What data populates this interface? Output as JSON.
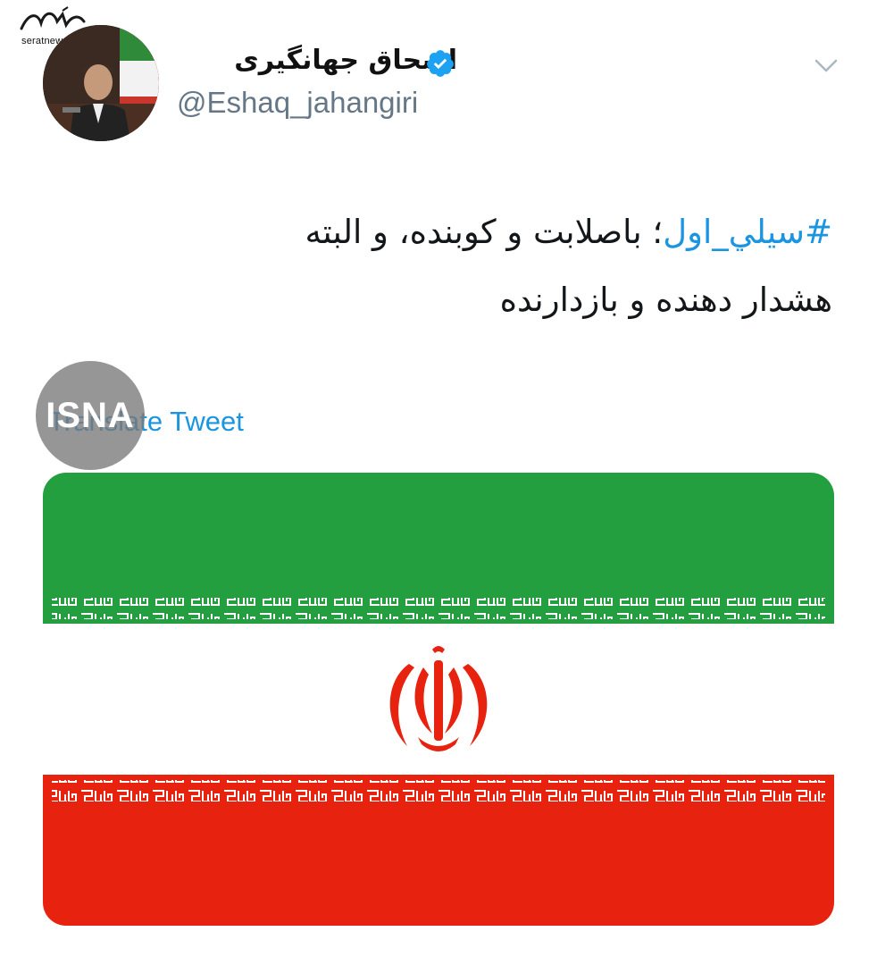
{
  "watermark": {
    "text": "seratnews.ir"
  },
  "tweet": {
    "author_name": "اسحاق جهانگیری",
    "handle": "@Eshaq_jahangiri",
    "hashtag": "#سیلي_اول",
    "text_line1_rest": "؛ باصلابت و کوبنده، و البته",
    "text_line2": "هشدار دهنده و بازدارنده",
    "translate_label": "Translate Tweet"
  },
  "overlay": {
    "isna_label": "ISNA"
  },
  "icons": {
    "verified": "verified-badge-icon",
    "chevron": "chevron-down-icon"
  },
  "colors": {
    "link_blue": "#1b95e0",
    "handle_gray": "#657786",
    "flag_green": "#239f40",
    "flag_white": "#ffffff",
    "flag_red": "#e7220f"
  }
}
